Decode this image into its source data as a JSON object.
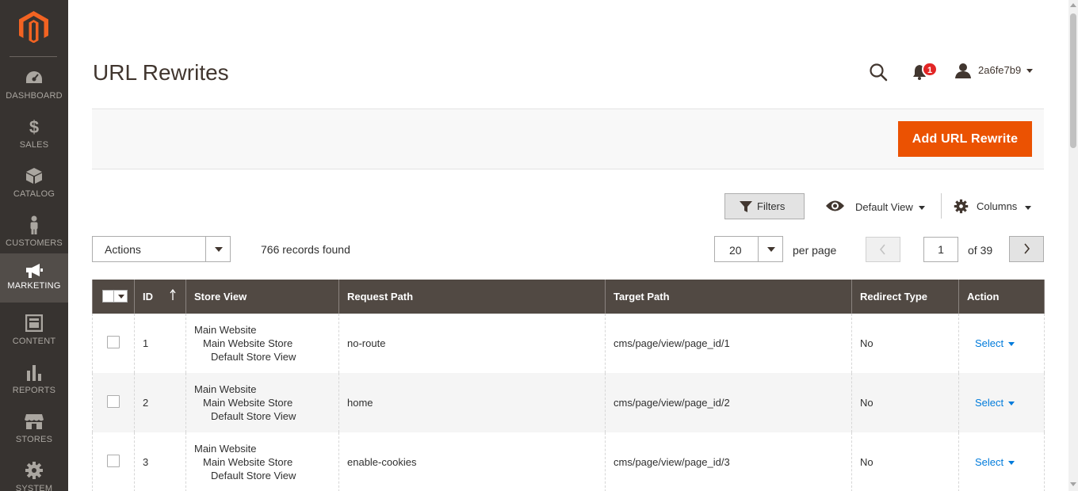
{
  "sidebar": {
    "items": [
      {
        "label": "DASHBOARD",
        "icon": "dashboard-icon"
      },
      {
        "label": "SALES",
        "icon": "dollar-icon"
      },
      {
        "label": "CATALOG",
        "icon": "box-icon"
      },
      {
        "label": "CUSTOMERS",
        "icon": "person-icon"
      },
      {
        "label": "MARKETING",
        "icon": "megaphone-icon",
        "active": true
      },
      {
        "label": "CONTENT",
        "icon": "layout-icon"
      },
      {
        "label": "REPORTS",
        "icon": "bar-chart-icon"
      },
      {
        "label": "STORES",
        "icon": "storefront-icon"
      },
      {
        "label": "SYSTEM",
        "icon": "gear-icon"
      }
    ]
  },
  "header": {
    "title": "URL Rewrites",
    "notifications_count": "1",
    "username": "2a6fe7b9"
  },
  "page_actions": {
    "add_button": "Add URL Rewrite"
  },
  "grid_controls": {
    "filters_label": "Filters",
    "view_label": "Default View",
    "columns_label": "Columns",
    "actions_label": "Actions",
    "records_found": "766 records found",
    "per_page_value": "20",
    "per_page_label": "per page",
    "current_page": "1",
    "total_pages": "of 39"
  },
  "table": {
    "columns": [
      "ID",
      "Store View",
      "Request Path",
      "Target Path",
      "Redirect Type",
      "Action"
    ],
    "rows": [
      {
        "id": "1",
        "store_view": [
          "Main Website",
          "Main Website Store",
          "Default Store View"
        ],
        "request_path": "no-route",
        "target_path": "cms/page/view/page_id/1",
        "redirect_type": "No",
        "action": "Select"
      },
      {
        "id": "2",
        "store_view": [
          "Main Website",
          "Main Website Store",
          "Default Store View"
        ],
        "request_path": "home",
        "target_path": "cms/page/view/page_id/2",
        "redirect_type": "No",
        "action": "Select"
      },
      {
        "id": "3",
        "store_view": [
          "Main Website",
          "Main Website Store",
          "Default Store View"
        ],
        "request_path": "enable-cookies",
        "target_path": "cms/page/view/page_id/3",
        "redirect_type": "No",
        "action": "Select"
      }
    ]
  },
  "colors": {
    "sidebar_bg": "#373330",
    "sidebar_active": "#524d49",
    "accent": "#eb5202",
    "table_header": "#514943",
    "link": "#007bdb",
    "badge": "#e22626"
  }
}
